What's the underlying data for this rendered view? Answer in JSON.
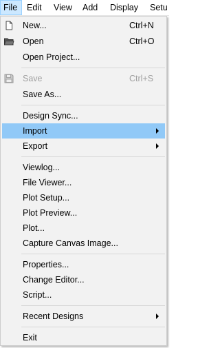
{
  "menubar": {
    "items": [
      "File",
      "Edit",
      "View",
      "Add",
      "Display",
      "Setu"
    ]
  },
  "file_menu": {
    "new": {
      "label": "New...",
      "shortcut": "Ctrl+N",
      "icon": "new-document-icon"
    },
    "open": {
      "label": "Open",
      "shortcut": "Ctrl+O",
      "icon": "folder-icon"
    },
    "open_project": {
      "label": "Open Project..."
    },
    "save": {
      "label": "Save",
      "shortcut": "Ctrl+S",
      "icon": "floppy-disk-icon",
      "disabled": true
    },
    "save_as": {
      "label": "Save As..."
    },
    "design_sync": {
      "label": "Design Sync..."
    },
    "import": {
      "label": "Import",
      "highlighted": true
    },
    "export": {
      "label": "Export"
    },
    "viewlog": {
      "label": "Viewlog..."
    },
    "file_viewer": {
      "label": "File Viewer..."
    },
    "plot_setup": {
      "label": "Plot Setup..."
    },
    "plot_preview": {
      "label": "Plot Preview..."
    },
    "plot": {
      "label": "Plot..."
    },
    "capture_canvas_image": {
      "label": "Capture Canvas Image..."
    },
    "properties": {
      "label": "Properties..."
    },
    "change_editor": {
      "label": "Change Editor..."
    },
    "script": {
      "label": "Script..."
    },
    "recent_designs": {
      "label": "Recent Designs"
    },
    "exit": {
      "label": "Exit"
    }
  },
  "colors": {
    "menu_background": "#f2f2f2",
    "highlight": "#91c9f7",
    "active_menubar_item": "#cce8ff",
    "disabled_text": "#a0a0a0"
  }
}
